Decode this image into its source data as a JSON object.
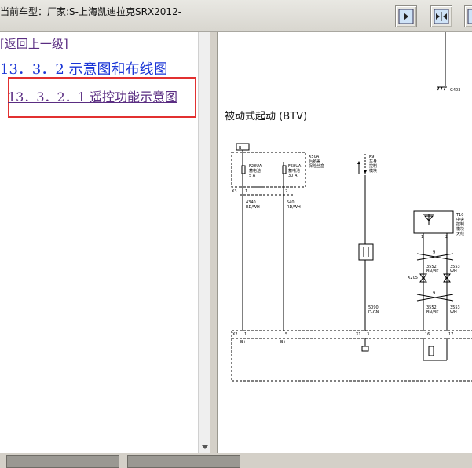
{
  "window": {
    "title": "当前车型：厂家:S-上海凯迪拉克SRX2012-"
  },
  "toolbar": {
    "buttons": [
      {
        "icon": "frame-right-icon"
      },
      {
        "icon": "frame-collapse-icon"
      },
      {
        "icon": "frame-expand-icon"
      }
    ]
  },
  "nav": {
    "back_link": "[返回上一级]",
    "section_title": "13．3．2 示意图和布线图",
    "subsection_link": "13．3．2．1 遥控功能示意图"
  },
  "diagram": {
    "title": "被动式起动 (BTV)",
    "labels": {
      "ground_top": "G403",
      "fuse_block_id": "X50A",
      "fuse_block_name_1": "后舱盖",
      "fuse_block_name_2": "保险丝盒",
      "fuse1_name": "F28UA",
      "fuse1_desc_1": "蓄电池",
      "fuse1_desc_2": "5 A",
      "fuse2_name": "F58UA",
      "fuse2_desc_1": "蓄电池",
      "fuse2_desc_2": "30 A",
      "conn_x3": "X3",
      "wire1_code": "4340",
      "wire1_color": "RD/WH",
      "wire2_code": "540",
      "wire2_color": "RD/WH",
      "k9": "K9",
      "k9_desc_1": "车身",
      "k9_desc_2": "控制",
      "k9_desc_3": "模块",
      "t10_id": "T10",
      "t10_desc_1": "中央",
      "t10_desc_2": "控制",
      "t10_desc_3": "模块",
      "t10_desc_4": "天线",
      "wire3_code": "5090",
      "wire3_color": "D-GN",
      "wire4_code": "3552",
      "wire4_color": "BN/BK",
      "wire5_code": "3553",
      "wire5_color": "WH",
      "conn_x205": "X205",
      "twist_9a": "9",
      "twist_9b": "9",
      "pin_1": "1",
      "pin_2": "2",
      "pin_3": "3",
      "pin_5": "5",
      "pin_16": "16",
      "pin_17": "17",
      "conn_x2": "X2",
      "conn_x1": "X1",
      "b_plus_1": "B+",
      "b_plus_2": "B+",
      "b_plus_3": "B+"
    }
  }
}
